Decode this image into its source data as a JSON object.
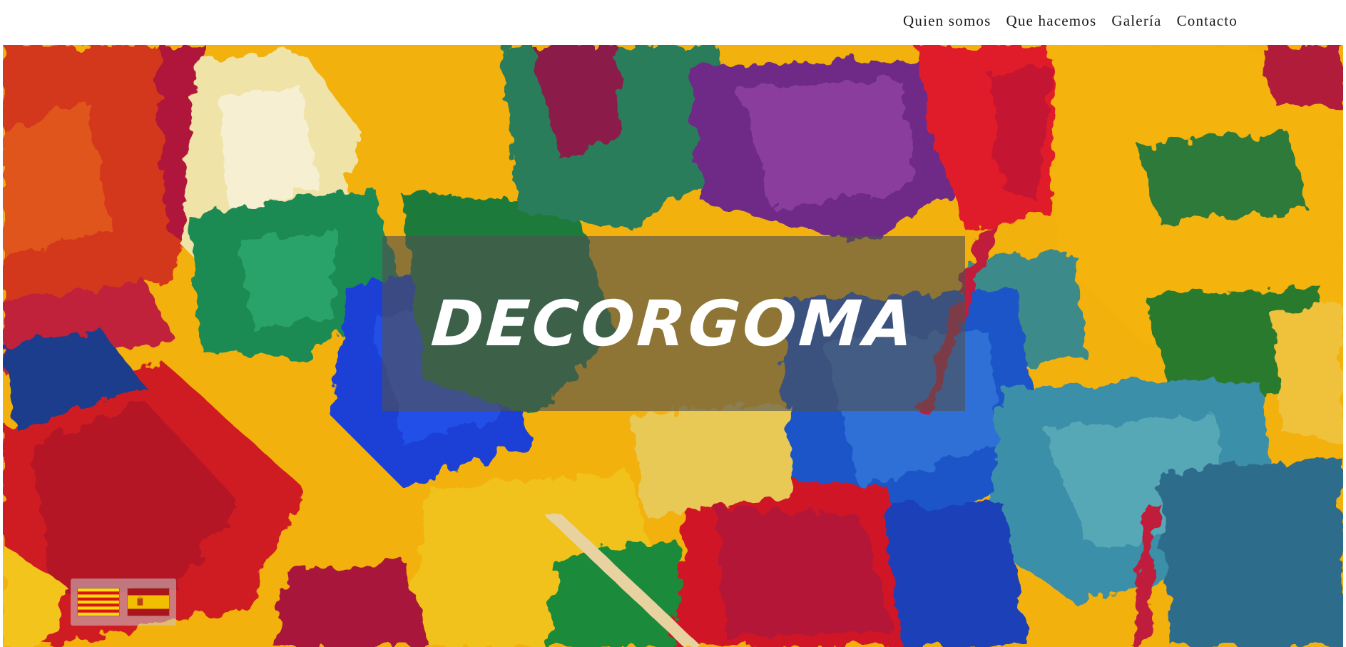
{
  "nav": {
    "items": [
      {
        "label": "Quien somos"
      },
      {
        "label": "Que hacemos"
      },
      {
        "label": "Galería"
      },
      {
        "label": "Contacto"
      }
    ]
  },
  "hero": {
    "title": "DECORGOMA",
    "background": "abstract-paint-image"
  },
  "language_switcher": {
    "flags": [
      {
        "icon": "catalan-flag-icon"
      },
      {
        "icon": "spanish-flag-icon"
      }
    ]
  },
  "colors": {
    "nav_text": "#1a1a1a",
    "title_text": "#ffffff",
    "title_overlay": "rgba(80,80,80,0.62)"
  }
}
